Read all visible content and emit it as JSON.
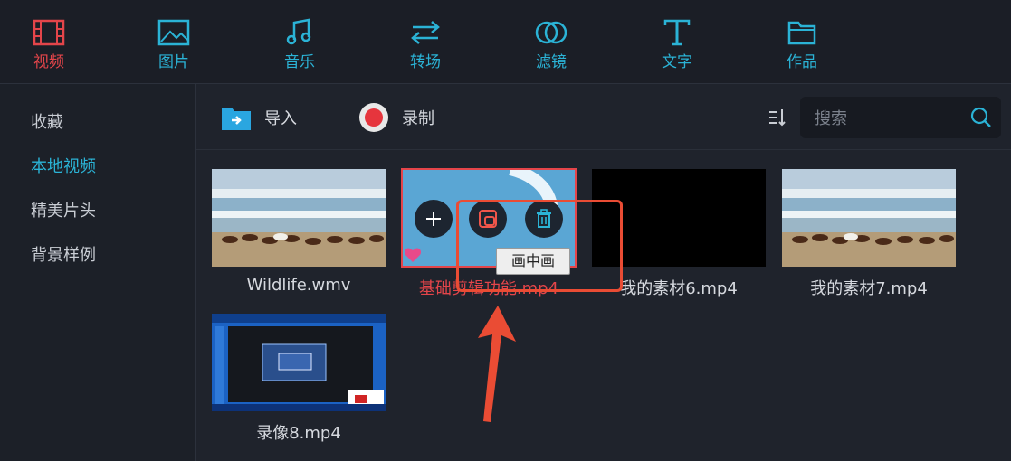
{
  "nav": {
    "tabs": [
      {
        "label": "视频",
        "icon": "film-icon",
        "active": true
      },
      {
        "label": "图片",
        "icon": "image-icon"
      },
      {
        "label": "音乐",
        "icon": "music-icon"
      },
      {
        "label": "转场",
        "icon": "transition-icon"
      },
      {
        "label": "滤镜",
        "icon": "filter-icon"
      },
      {
        "label": "文字",
        "icon": "text-icon"
      },
      {
        "label": "作品",
        "icon": "folder-icon"
      }
    ]
  },
  "sidebar": {
    "items": [
      {
        "label": "收藏"
      },
      {
        "label": "本地视频",
        "active": true
      },
      {
        "label": "精美片头"
      },
      {
        "label": "背景样例"
      }
    ]
  },
  "toolbar": {
    "import_label": "导入",
    "record_label": "录制",
    "search_placeholder": "搜索"
  },
  "media": {
    "items": [
      {
        "name": "Wildlife.wmv"
      },
      {
        "name": "基础剪辑功能.mp4",
        "selected": true
      },
      {
        "name": "我的素材6.mp4"
      },
      {
        "name": "我的素材7.mp4"
      },
      {
        "name": "录像8.mp4"
      }
    ]
  },
  "tooltip": {
    "text": "画中画"
  },
  "colors": {
    "accent": "#2bb3d6",
    "active": "#e4454a",
    "annotation": "#ea4c34"
  }
}
